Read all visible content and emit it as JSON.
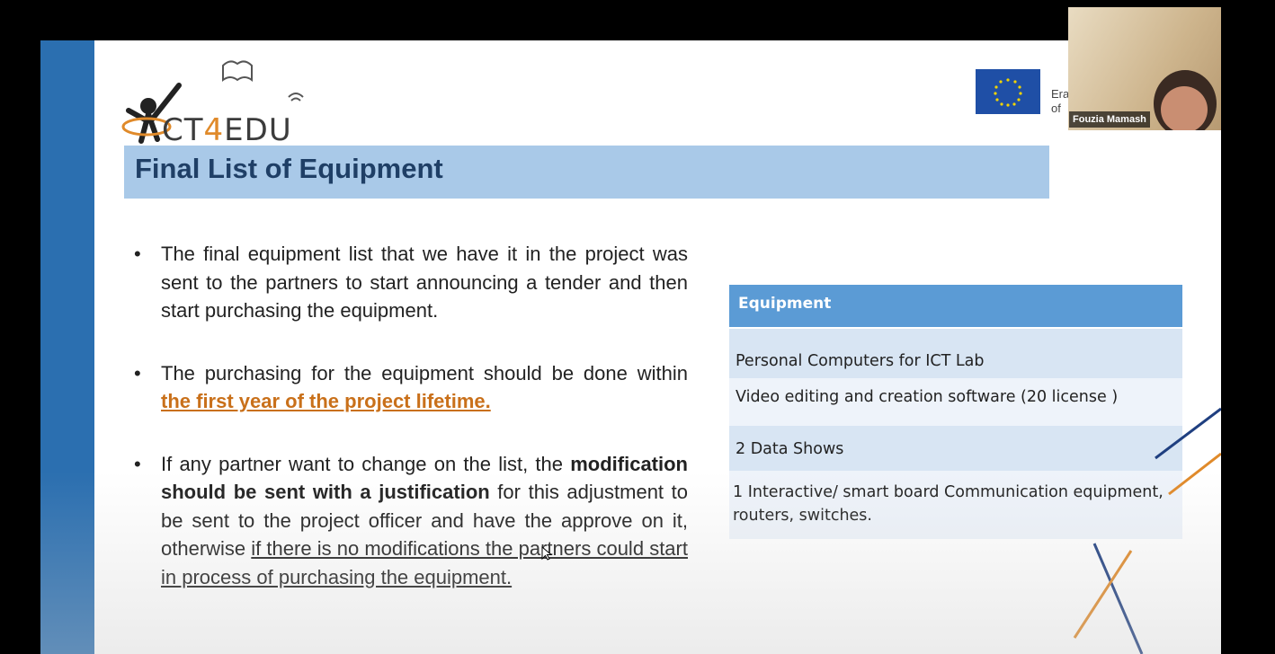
{
  "slide": {
    "logo": {
      "text_prefix": "CT",
      "text_four": "4",
      "text_suffix": "EDU",
      "icon": "book-child-logo"
    },
    "eu": {
      "flag_icon": "eu-flag-icon",
      "line1": "Era",
      "line2": "of"
    },
    "title": "Final List of Equipment",
    "bullets": [
      {
        "text": "The final equipment list that we have it in the project was sent to the partners to start announcing a tender and then start purchasing the equipment."
      },
      {
        "text_before": "The purchasing for the equipment should be done within ",
        "highlight": "the first year of the project lifetime."
      },
      {
        "text_before": "If any partner want to change on the list, the ",
        "bold": "modification should be sent with a justification",
        "text_middle": " for this adjustment to be sent to the project officer and have the approve on it, otherwise ",
        "underlined": "if there is no modifications the partners could start in process of purchasing the equipment."
      }
    ],
    "table": {
      "header": "Equipment",
      "rows": [
        "Personal Computers for ICT Lab",
        "Video editing and creation software (20 license )",
        "2 Data Shows",
        "1 Interactive/ smart board Communication equipment, routers, switches."
      ]
    }
  },
  "video_tile": {
    "participant_name": "Fouzia Mamash"
  },
  "colors": {
    "accent_blue": "#2b6fb0",
    "title_bar": "#a9c9e8",
    "table_header": "#5b9bd5",
    "highlight_orange": "#c9701a"
  }
}
